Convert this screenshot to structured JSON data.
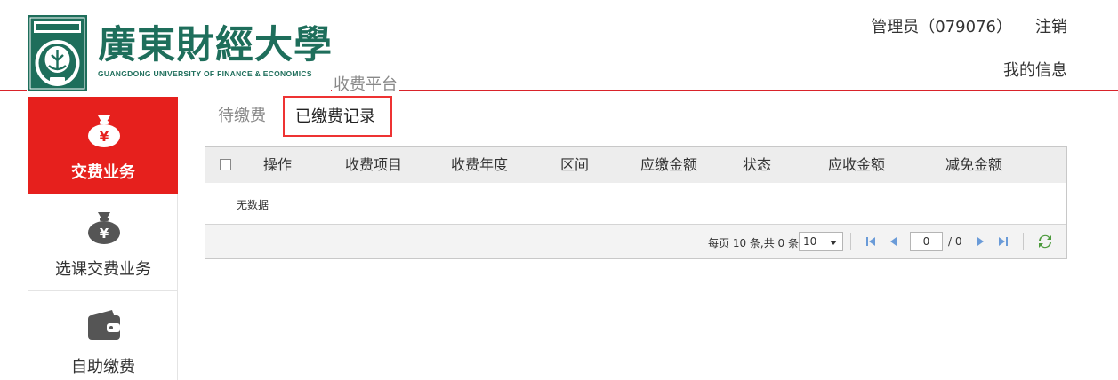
{
  "header": {
    "logo_cn": "廣東財經大學",
    "logo_en": "GUANGDONG UNIVERSITY OF FINANCE & ECONOMICS",
    "user_label": "管理员（079076）",
    "logout_label": "注销",
    "my_info_label": "我的信息",
    "platform_title": "收费平台"
  },
  "sidebar": {
    "items": [
      {
        "label": "交费业务",
        "icon": "money-bag-icon",
        "active": true
      },
      {
        "label": "选课交费业务",
        "icon": "money-bag-icon",
        "active": false
      },
      {
        "label": "自助缴费",
        "icon": "wallet-icon",
        "active": false
      }
    ]
  },
  "tabs": [
    {
      "label": "待缴费",
      "active": false
    },
    {
      "label": "已缴费记录",
      "active": true
    }
  ],
  "table": {
    "columns": [
      "操作",
      "收费项目",
      "收费年度",
      "区间",
      "应缴金额",
      "状态",
      "应收金额",
      "减免金额"
    ],
    "empty_text": "无数据"
  },
  "pager": {
    "summary": "每页 10 条,共 0 条",
    "page_size": "10",
    "current_page": "0",
    "total_pages": "/ 0"
  },
  "colors": {
    "accent_red": "#e6201d",
    "brand_green": "#1e6e5b",
    "header_line": "#d9232a"
  }
}
